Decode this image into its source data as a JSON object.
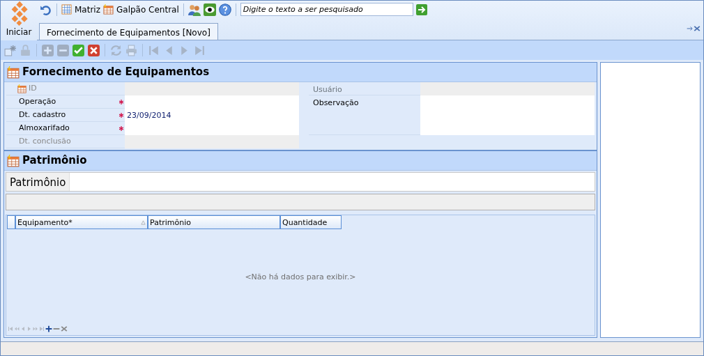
{
  "top_bar": {
    "items": [
      {
        "kind": "undo"
      },
      {
        "kind": "grid",
        "label": "Matriz"
      },
      {
        "kind": "chart",
        "label": "Galpão Central"
      },
      {
        "kind": "users"
      },
      {
        "kind": "eye"
      },
      {
        "kind": "help"
      }
    ],
    "search": {
      "placeholder": "Digite o texto a ser pesquisado"
    }
  },
  "start_label": "Iniciar",
  "tabs": [
    {
      "label": "Fornecimento de Equipamentos [Novo]",
      "selected": true
    }
  ],
  "toolbar": [
    {
      "kind": "new",
      "disabled": true
    },
    {
      "kind": "lock",
      "disabled": true
    },
    {
      "kind": "add",
      "disabled": true
    },
    {
      "kind": "remove",
      "disabled": true
    },
    {
      "kind": "ok",
      "disabled": false
    },
    {
      "kind": "cancel",
      "disabled": false
    },
    {
      "kind": "refresh",
      "disabled": true
    },
    {
      "kind": "print",
      "disabled": true
    },
    {
      "kind": "first",
      "disabled": true
    },
    {
      "kind": "prev",
      "disabled": true
    },
    {
      "kind": "next",
      "disabled": true
    },
    {
      "kind": "last",
      "disabled": true
    }
  ],
  "form": {
    "title": "Fornecimento de Equipamentos",
    "left_fields": [
      {
        "label": "ID",
        "required": false,
        "disabled": true
      },
      {
        "label": "Operação",
        "required": true,
        "disabled": false
      },
      {
        "label": "Dt. cadastro",
        "required": true,
        "disabled": false,
        "value": "23/09/2014"
      },
      {
        "label": "Almoxarifado",
        "required": true,
        "disabled": false
      },
      {
        "label": "Dt. conclusão",
        "required": false,
        "disabled": true
      }
    ],
    "right_fields": [
      {
        "label": "Usuário",
        "disabled": true,
        "kind": "text"
      },
      {
        "label": "Observação",
        "disabled": false,
        "kind": "memo"
      }
    ]
  },
  "patrimonio": {
    "title": "Patrimônio",
    "search_label": "Patrimônio",
    "table": {
      "columns": [
        {
          "label": "Equipamento*",
          "sorted": true
        },
        {
          "label": "Patrimônio",
          "sorted": false
        },
        {
          "label": "Quantidade",
          "sorted": false
        }
      ],
      "empty_text": "<Não há dados para exibir.>"
    },
    "navigator": [
      {
        "kind": "first",
        "disabled": true
      },
      {
        "kind": "prevpage",
        "disabled": true
      },
      {
        "kind": "prev",
        "disabled": true
      },
      {
        "kind": "next",
        "disabled": true
      },
      {
        "kind": "nextpage",
        "disabled": true
      },
      {
        "kind": "last",
        "disabled": true
      },
      {
        "kind": "add",
        "disabled": false
      },
      {
        "kind": "remove",
        "disabled": true
      },
      {
        "kind": "cancel",
        "disabled": true
      }
    ]
  }
}
